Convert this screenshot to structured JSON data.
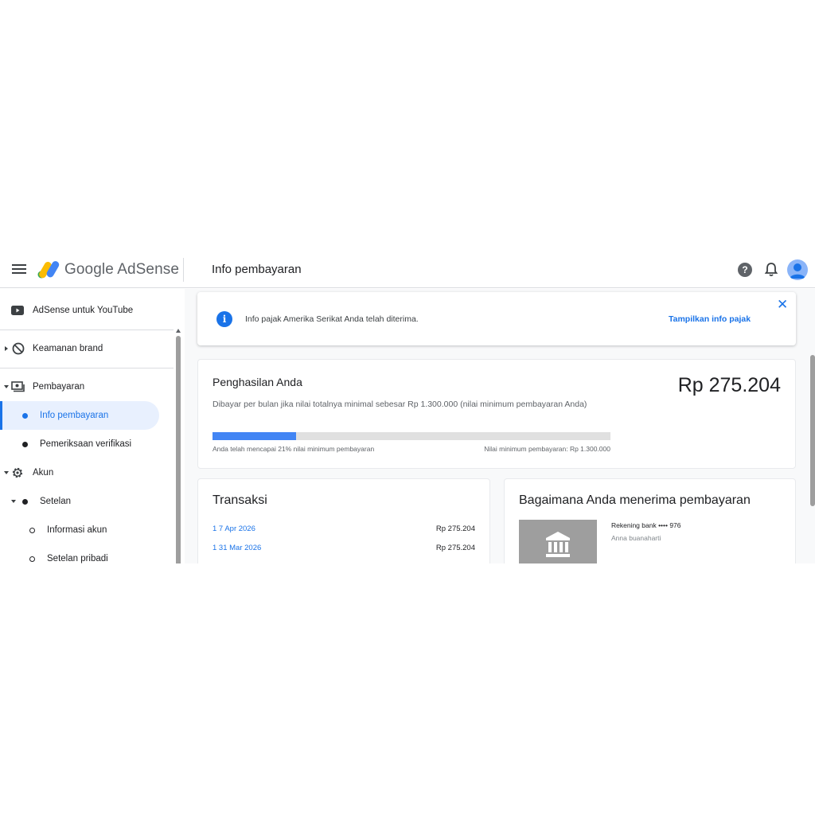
{
  "header": {
    "brand": "Google AdSense",
    "page_title": "Info pembayaran",
    "menu_icon": "hamburger-menu-icon",
    "help_icon": "help-icon",
    "notifications_icon": "bell-icon",
    "avatar_icon": "account-avatar-icon"
  },
  "sidebar": {
    "items": [
      {
        "label": "AdSense untuk YouTube",
        "icon": "youtube-icon"
      },
      {
        "label": "Keamanan brand",
        "icon": "block-icon"
      },
      {
        "label": "Pembayaran",
        "icon": "payments-icon"
      },
      {
        "label": "Info pembayaran",
        "active": true
      },
      {
        "label": "Pemeriksaan verifikasi"
      },
      {
        "label": "Akun",
        "icon": "gear-icon"
      },
      {
        "label": "Setelan"
      },
      {
        "label": "Informasi akun"
      },
      {
        "label": "Setelan pribadi"
      }
    ]
  },
  "banner": {
    "message": "Info pajak Amerika Serikat Anda telah diterima.",
    "link": "Tampilkan info pajak",
    "close": "✕"
  },
  "earnings": {
    "title": "Penghasilan Anda",
    "amount": "Rp 275.204",
    "subtitle": "Dibayar per bulan jika nilai totalnya minimal sebesar Rp 1.300.000 (nilai minimum pembayaran Anda)",
    "progress_fraction": 0.21,
    "progress_label": "Anda telah mencapai 21% nilai minimum pembayaran",
    "threshold_label": "Nilai minimum pembayaran: Rp 1.300.000"
  },
  "transactions": {
    "title": "Transaksi",
    "rows": [
      {
        "date": "1  7 Apr 2026",
        "amount": "Rp 275.204"
      },
      {
        "date": "1  31 Mar 2026",
        "amount": "Rp 275.204"
      }
    ]
  },
  "payment_method": {
    "title": "Bagaimana Anda menerima pembayaran",
    "bank_label": "Rekening bank •••• 976",
    "holder": "Anna buanaharti",
    "icon": "bank-icon"
  },
  "colors": {
    "accent": "#1a73e8",
    "progress_fill": "#4285f4",
    "active_nav_bg": "#e8f0fe"
  }
}
